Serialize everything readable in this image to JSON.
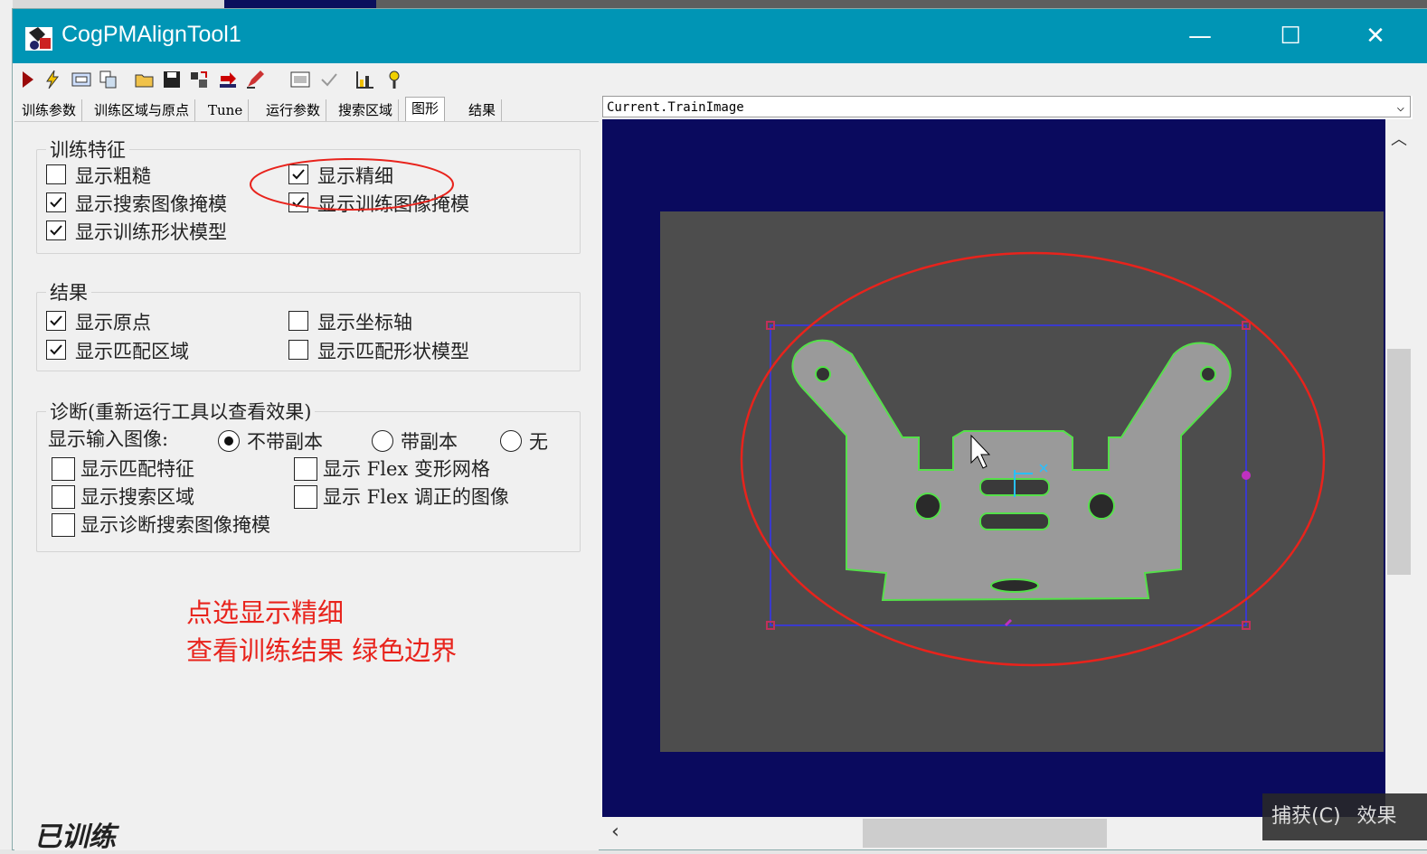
{
  "window": {
    "title": "CogPMAlignTool1",
    "minimize": "—",
    "maximize": "☐",
    "close": "✕"
  },
  "toolbar": {
    "icons": [
      "run-icon",
      "lightning-icon",
      "display-icon",
      "copy-icon",
      "open-icon",
      "save-icon",
      "reset-icon",
      "import-icon",
      "edit-icon",
      "image-icon",
      "check-icon",
      "chart-icon",
      "help-icon"
    ]
  },
  "tabs": [
    "训练参数",
    "训练区域与原点",
    "Tune",
    "运行参数",
    "搜索区域",
    "图形",
    "结果"
  ],
  "active_tab": "图形",
  "train_features": {
    "title": "训练特征",
    "show_coarse": {
      "label": "显示粗糙",
      "checked": false
    },
    "show_fine": {
      "label": "显示精细",
      "checked": true
    },
    "show_search_mask": {
      "label": "显示搜索图像掩模",
      "checked": true
    },
    "show_train_mask": {
      "label": "显示训练图像掩模",
      "checked": true
    },
    "show_train_shape": {
      "label": "显示训练形状模型",
      "checked": true
    }
  },
  "results": {
    "title": "结果",
    "show_origin": {
      "label": "显示原点",
      "checked": true
    },
    "show_axes": {
      "label": "显示坐标轴",
      "checked": false
    },
    "show_match_region": {
      "label": "显示匹配区域",
      "checked": true
    },
    "show_match_shape": {
      "label": "显示匹配形状模型",
      "checked": false
    }
  },
  "diagnostics": {
    "title": "诊断(重新运行工具以查看效果)",
    "input_image_label": "显示输入图像:",
    "radio_no_copy": "不带副本",
    "radio_with_copy": "带副本",
    "radio_none": "无",
    "selected": "不带副本",
    "show_match_features": {
      "label": "显示匹配特征",
      "checked": false
    },
    "show_flex_grid": {
      "label": "显示 Flex 变形网格",
      "checked": false
    },
    "show_search_region": {
      "label": "显示搜索区域",
      "checked": false
    },
    "show_flex_image": {
      "label": "显示 Flex 调正的图像",
      "checked": false
    },
    "show_diag_mask": {
      "label": "显示诊断搜索图像掩模",
      "checked": false
    }
  },
  "annotation": {
    "line1": "点选显示精细",
    "line2": "查看训练结果 绿色边界",
    "color": "#e8231c"
  },
  "status": "已训练",
  "image_view": {
    "selected_image": "Current.TrainImage"
  },
  "overlay": {
    "capture": "捕获(C)",
    "effect": "效果"
  }
}
